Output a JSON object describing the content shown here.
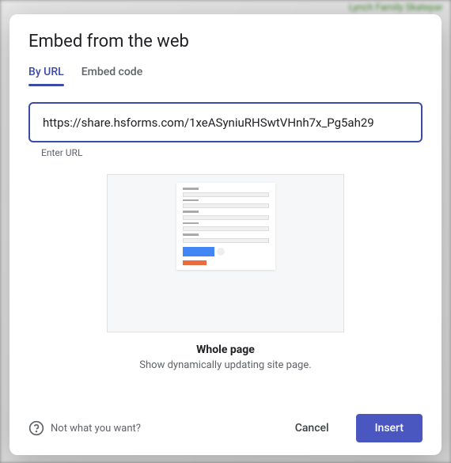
{
  "backdrop": {
    "label": "Lynch Family Skatepar"
  },
  "dialog": {
    "title": "Embed from the web",
    "tabs": {
      "byUrl": "By URL",
      "embedCode": "Embed code"
    },
    "url": {
      "value": "https://share.hsforms.com/1xeASyniuRHSwtVHnh7x_Pg5ah29",
      "helper": "Enter URL"
    },
    "preview": {
      "title": "Whole page",
      "subtitle": "Show dynamically updating site page."
    },
    "footer": {
      "help": "Not what you want?",
      "cancel": "Cancel",
      "insert": "Insert"
    }
  }
}
